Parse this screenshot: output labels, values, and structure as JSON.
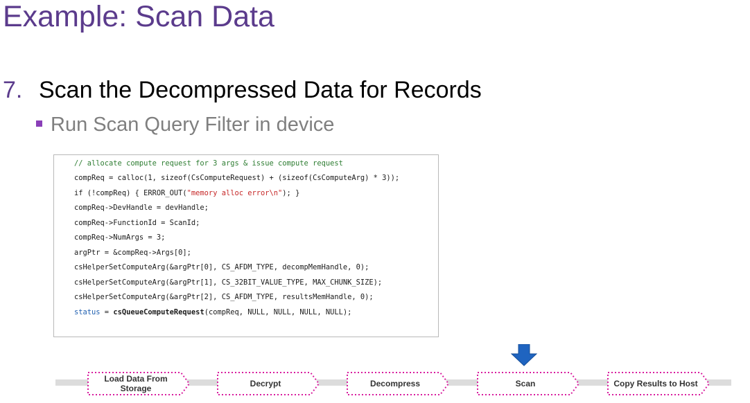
{
  "slide": {
    "title": "Example: Scan Data",
    "step_number": "7.",
    "step_heading": "Scan the Decompressed Data for Records",
    "bullet": "Run Scan Query Filter in device"
  },
  "code": {
    "lines": [
      "// allocate compute request for 3 args & issue compute request",
      "compReq = calloc(1, sizeof(CsComputeRequest) + (sizeof(CsComputeArg) * 3));",
      "if (!compReq) { ERROR_OUT(\"memory alloc error\\n\"); }",
      "compReq->DevHandle = devHandle;",
      "compReq->FunctionId = ScanId;",
      "compReq->NumArgs = 3;",
      "argPtr = &compReq->Args[0];",
      "csHelperSetComputeArg(&argPtr[0], CS_AFDM_TYPE, decompMemHandle, 0);",
      "csHelperSetComputeArg(&argPtr[1], CS_32BIT_VALUE_TYPE, MAX_CHUNK_SIZE);",
      "csHelperSetComputeArg(&argPtr[2], CS_AFDM_TYPE, resultsMemHandle, 0);",
      "status = csQueueComputeRequest(compReq, NULL, NULL, NULL, NULL);"
    ],
    "line3_prefix": "if (!compReq) { ERROR_OUT(",
    "line3_string": "\"memory alloc error\\n\"",
    "line3_suffix": "); }",
    "last_var": "status",
    "last_eq": " = ",
    "last_fn": "csQueueComputeRequest",
    "last_args": "(compReq, NULL, NULL, NULL, NULL);"
  },
  "pipeline": {
    "stages": [
      {
        "label": "Load Data From Storage",
        "active": false
      },
      {
        "label": "Decrypt",
        "active": false
      },
      {
        "label": "Decompress",
        "active": false
      },
      {
        "label": "Scan",
        "active": true
      },
      {
        "label": "Copy Results to Host",
        "active": false
      }
    ],
    "indicator_icon": "down-arrow-icon"
  },
  "colors": {
    "title": "#5b3b8c",
    "bullet_marker": "#8a3fb8",
    "stage_border": "#d81b9e",
    "arrow": "#1f64c0",
    "track": "#dcdcdc"
  }
}
